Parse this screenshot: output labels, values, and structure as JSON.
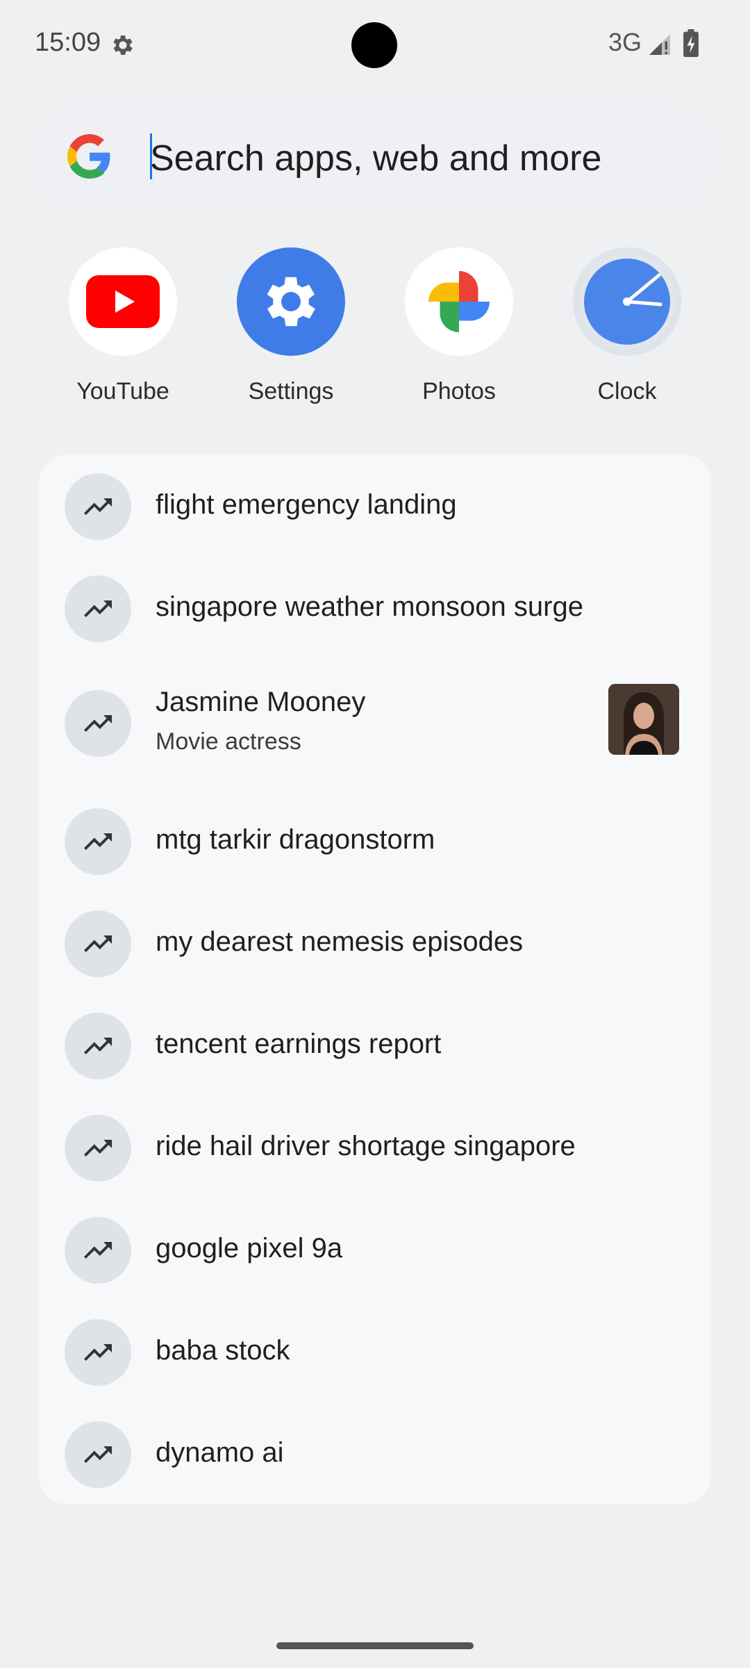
{
  "status_bar": {
    "time": "15:09",
    "network": "3G",
    "icons": [
      "settings-gear-icon",
      "signal-icon",
      "battery-icon"
    ]
  },
  "search": {
    "placeholder": "Search apps, web and more",
    "logo": "google-g-icon"
  },
  "apps": [
    {
      "label": "YouTube",
      "icon": "youtube-icon"
    },
    {
      "label": "Settings",
      "icon": "settings-icon"
    },
    {
      "label": "Photos",
      "icon": "photos-icon"
    },
    {
      "label": "Clock",
      "icon": "clock-icon"
    }
  ],
  "suggestions": [
    {
      "text": "flight emergency landing",
      "icon": "trending-up-icon"
    },
    {
      "text": "singapore weather monsoon surge",
      "icon": "trending-up-icon"
    },
    {
      "text": "Jasmine Mooney",
      "subtitle": "Movie actress",
      "icon": "trending-up-icon",
      "thumbnail": "person-photo"
    },
    {
      "text": "mtg tarkir dragonstorm",
      "icon": "trending-up-icon"
    },
    {
      "text": "my dearest nemesis episodes",
      "icon": "trending-up-icon"
    },
    {
      "text": "tencent earnings report",
      "icon": "trending-up-icon"
    },
    {
      "text": "ride hail driver shortage singapore",
      "icon": "trending-up-icon"
    },
    {
      "text": "google pixel 9a",
      "icon": "trending-up-icon"
    },
    {
      "text": "baba stock",
      "icon": "trending-up-icon"
    },
    {
      "text": "dynamo ai",
      "icon": "trending-up-icon"
    }
  ],
  "colors": {
    "background": "#eff0f2",
    "panel": "#f7f8fa",
    "trend_circle": "#dfe2e6",
    "accent": "#1a73e8"
  }
}
